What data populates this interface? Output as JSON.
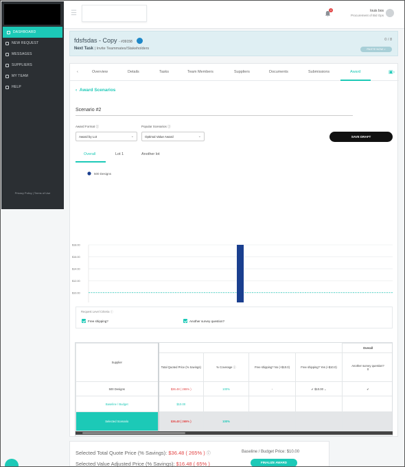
{
  "sidebar": {
    "items": [
      {
        "label": "DASHBOARD",
        "icon": "dashboard-icon"
      },
      {
        "label": "NEW REQUEST",
        "icon": "new-request-icon"
      },
      {
        "label": "MESSAGES",
        "icon": "messages-icon"
      },
      {
        "label": "SUPPLIERS",
        "icon": "suppliers-icon"
      },
      {
        "label": "MY TEAM",
        "icon": "team-icon"
      },
      {
        "label": "HELP",
        "icon": "help-icon"
      }
    ],
    "footer": "Privacy Policy | Terms of Use"
  },
  "topbar": {
    "notification_count": "4",
    "user_name": "louis bos",
    "user_role": "Procurement of Bid Ops"
  },
  "project": {
    "title": "fdsfsdas - Copy",
    "id": "- #39158",
    "next_task_label": "Next Task",
    "next_task_text": "| Invite Teammates/Stakeholders",
    "counter": "0 / 8",
    "paste_now": "PASTE NOW >"
  },
  "tabs": [
    "Overview",
    "Details",
    "Tasks",
    "Team Members",
    "Suppliers",
    "Documents",
    "Submissions",
    "Award"
  ],
  "award": {
    "back_label": "Award Scenarios",
    "scenario_name": "Scenario #2",
    "award_format_label": "Award Format",
    "award_format_value": "Award by Lot",
    "popular_label": "Popular Scenarios",
    "popular_value": "Optimal Value Award",
    "save_draft": "SAVE DRAFT",
    "subtabs": [
      "Overall",
      "Lot 1",
      "Another lot"
    ]
  },
  "chart_data": {
    "type": "bar",
    "categories": [
      "Quotes by Supplier"
    ],
    "series": [
      {
        "name": "500 Designs",
        "values": [
          36.48
        ]
      }
    ],
    "xlabel": "Quotes by Supplier",
    "ylim": [
      0,
      18
    ],
    "yticks": [
      "$0.00",
      "$2.00",
      "$4.00",
      "$6.00",
      "$8.00",
      "$10.00",
      "$12.00",
      "$14.00",
      "$16.00",
      "$18.00"
    ],
    "baseline": 10.0,
    "bar_color": "#1a3f8f",
    "baseline_color": "#1cc9b7",
    "legend_position": "top-left",
    "grid": true
  },
  "criteria": {
    "title": "Request Level Criteria",
    "items": [
      "Free shipping?",
      "Another survey question?"
    ]
  },
  "table": {
    "overall": "Overall",
    "headers": [
      "Supplier",
      "Total Quoted Price (% Savings)",
      "% Coverage",
      "Free shipping? No (+$10.0)",
      "Free shipping? Yes (+$10.0)",
      "Another survey question?"
    ],
    "another_q_sub": "0",
    "rows": [
      {
        "supplier": "500 Designs",
        "price": "$36.48 ( 265% )",
        "coverage": "100%",
        "no": "-",
        "yes": "✔ $10.00 ⌄",
        "other": "✔"
      },
      {
        "supplier": "Baseline / Budget",
        "price": "$10.00",
        "coverage": "",
        "no": "",
        "yes": "",
        "other": ""
      },
      {
        "supplier": "Selected Scenario",
        "price": "$36.48 ( 265% )",
        "coverage": "100%",
        "no": "",
        "yes": "",
        "other": ""
      }
    ]
  },
  "summary": {
    "total_label": "Selected Total Quote Price (% Savings):",
    "total_value": "$36.48 ( 265% )",
    "adjusted_label": "Selected Value Adjusted Price (% Savings):",
    "adjusted_value": "$16.48 ( 65% )",
    "baseline": "Baseline / Budget Price: $10.00",
    "finalize": "FINALIZE AWARD"
  }
}
